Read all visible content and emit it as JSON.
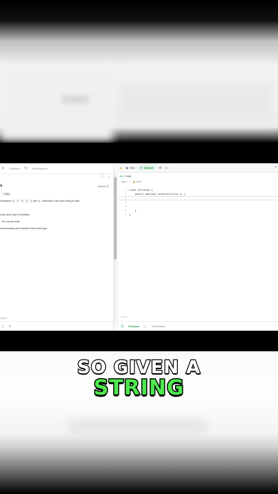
{
  "left": {
    "tabs": [
      "Solutions",
      "Submissions"
    ],
    "title_fragment": "s",
    "solved": "Solved",
    "tag": "Hint",
    "desc_line1_prefix": "characters",
    "desc_line1_codes": [
      "'('",
      "')'",
      "'{'",
      "'}'",
      "'['",
      "']'"
    ],
    "desc_line1_and": "and",
    "desc_line1_suffix": ", determine if the input string is valid.",
    "desc_line2": "y the same type of brackets.",
    "desc_line3": "the correct order.",
    "desc_line4": "orresponding open bracket of the same type.",
    "foot_note": "Saved"
  },
  "toolbar": {
    "run_label": "Run",
    "submit_label": "Submit"
  },
  "code_panel": {
    "header": "Code",
    "lang": "Java",
    "auto": "Auto",
    "lines": [
      {
        "n": "1",
        "text": "class Solution {"
      },
      {
        "n": "2",
        "text": "    public boolean isValid(String s) {"
      },
      {
        "n": "3",
        "text": ""
      },
      {
        "n": "4",
        "text": ""
      },
      {
        "n": "5",
        "text": ""
      },
      {
        "n": "6",
        "text": "    }"
      },
      {
        "n": "7",
        "text": "}"
      }
    ],
    "saved": "Saved"
  },
  "bottom": {
    "testcase": "Testcase",
    "test_result": "Test Result"
  },
  "captions": {
    "line1": "SO GIVEN A",
    "line2": "STRING"
  },
  "colors": {
    "accent_green": "#1a9f4b",
    "caption_green": "#4ee84e"
  }
}
